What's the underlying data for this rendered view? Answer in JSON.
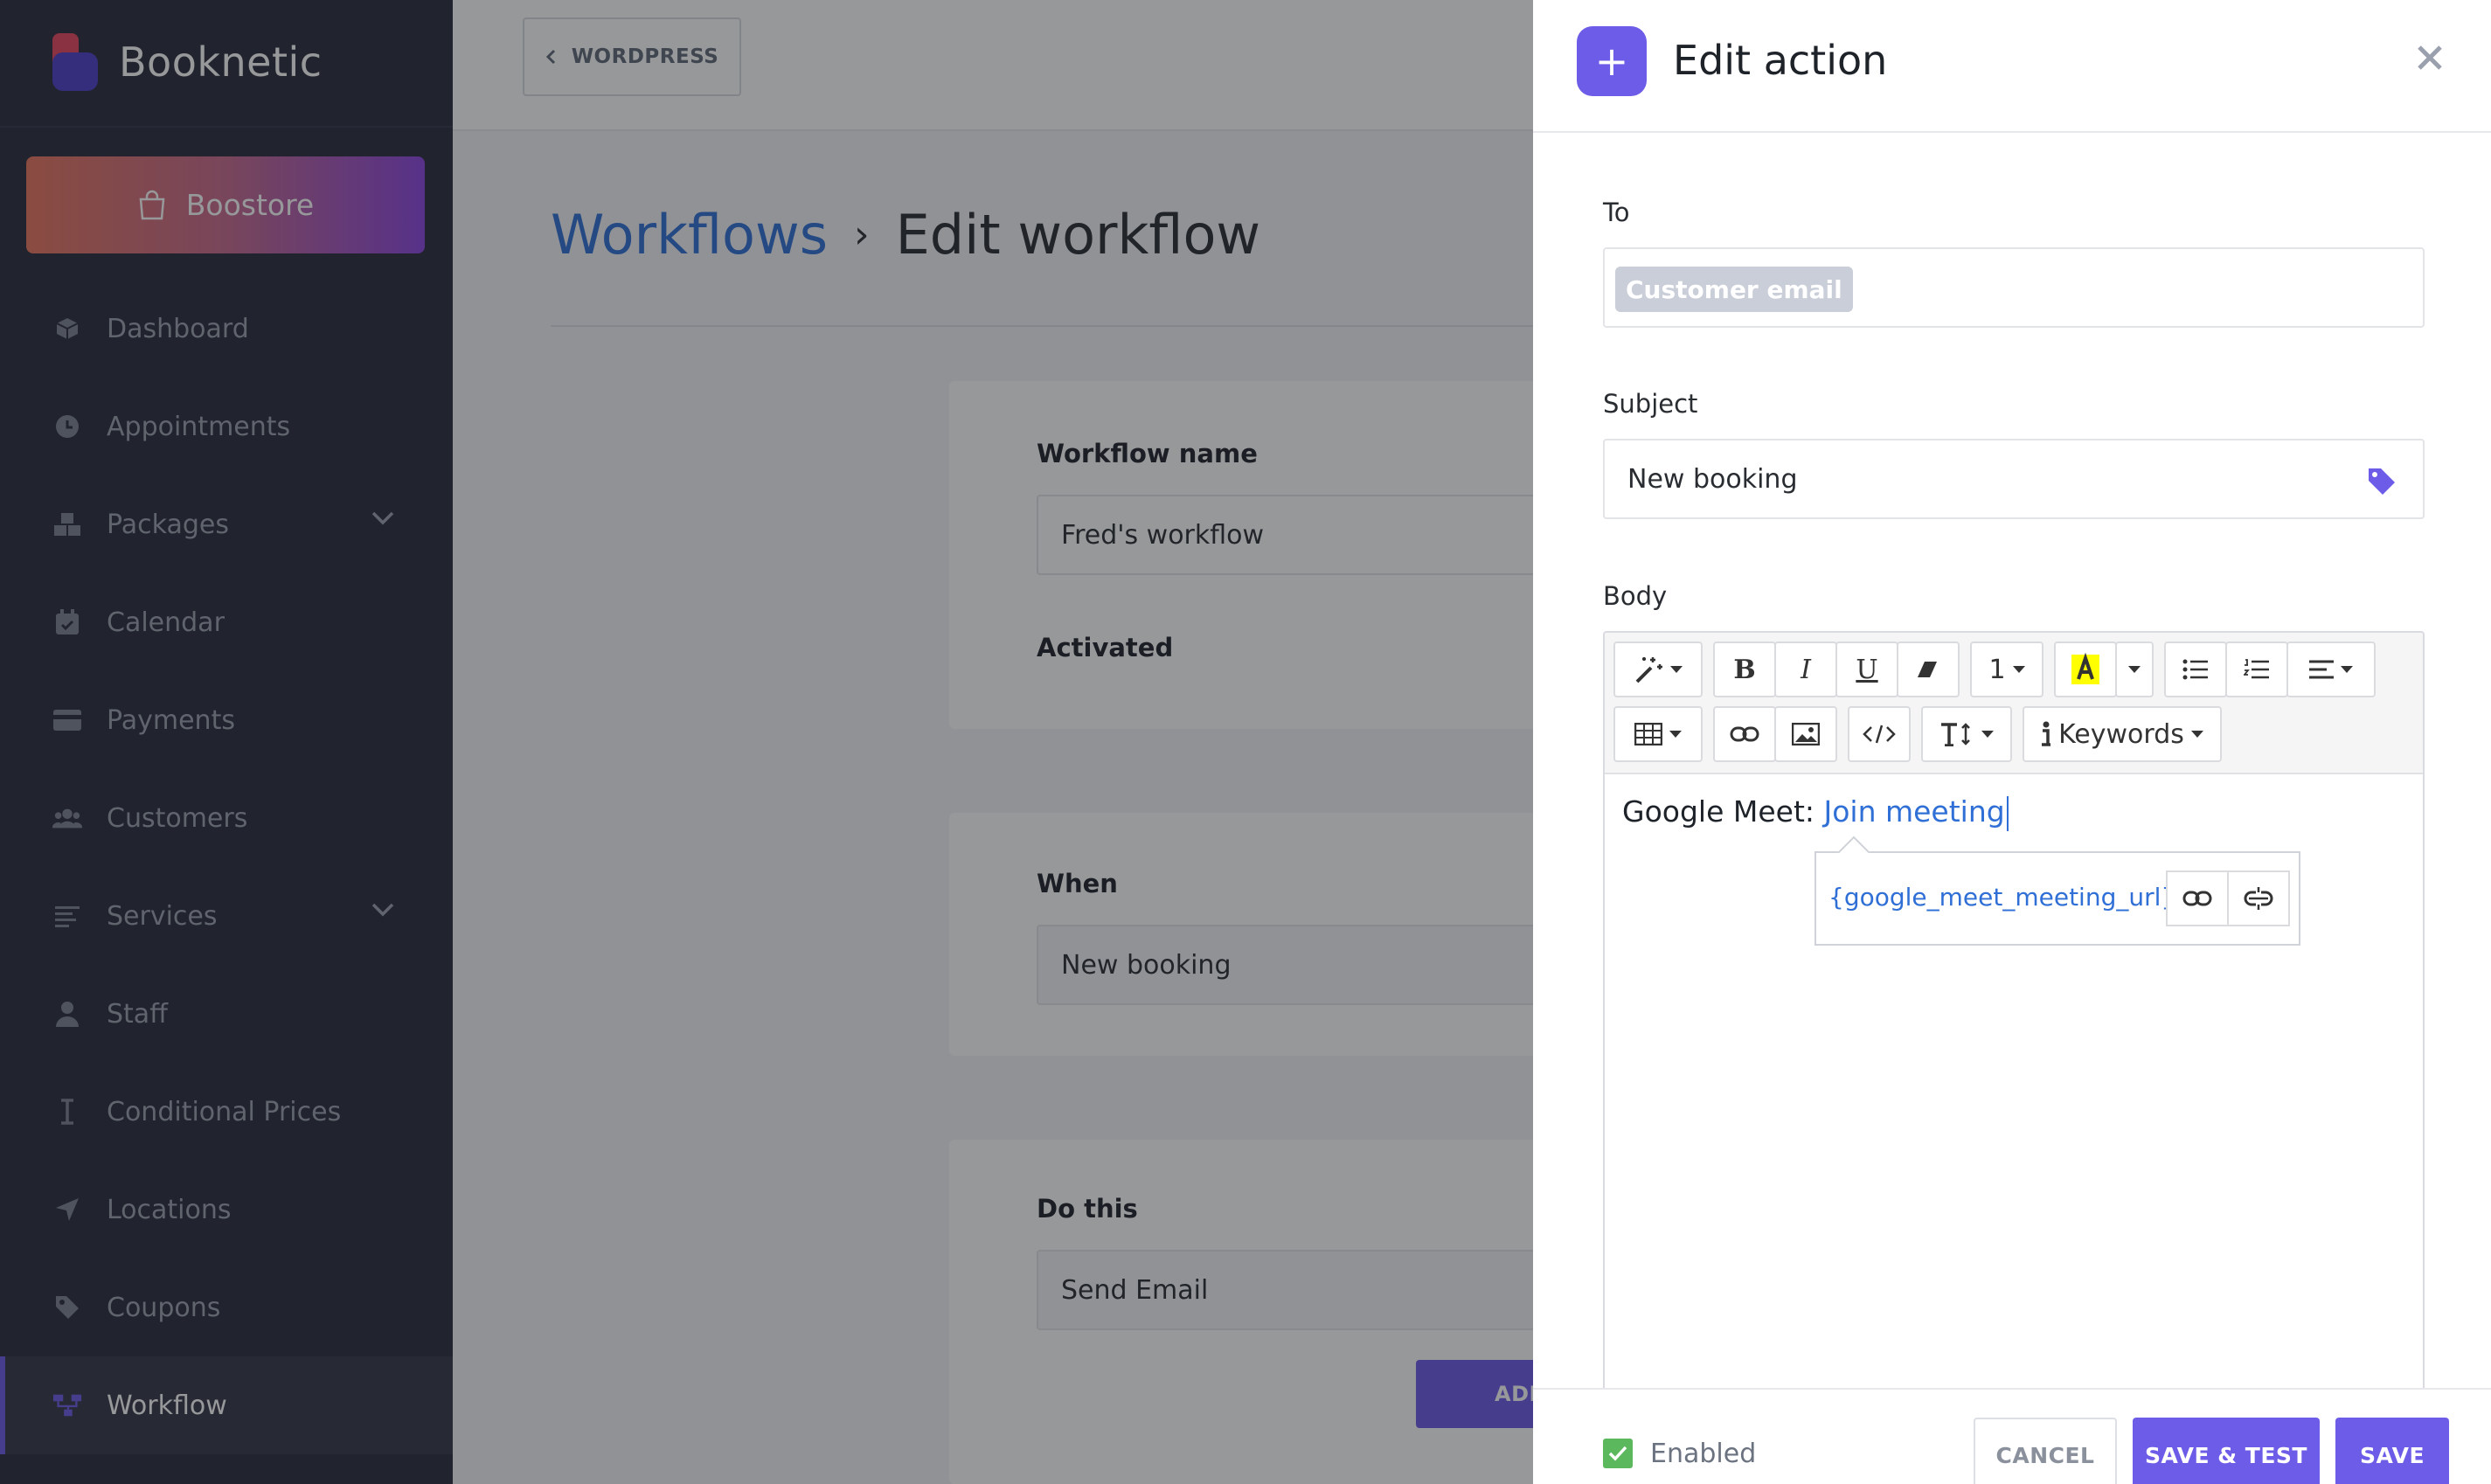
{
  "sidebar": {
    "brand": "Booknetic",
    "boostore_label": "Boostore",
    "items": [
      {
        "label": "Dashboard"
      },
      {
        "label": "Appointments"
      },
      {
        "label": "Packages"
      },
      {
        "label": "Calendar"
      },
      {
        "label": "Payments"
      },
      {
        "label": "Customers"
      },
      {
        "label": "Services"
      },
      {
        "label": "Staff"
      },
      {
        "label": "Conditional Prices"
      },
      {
        "label": "Locations"
      },
      {
        "label": "Coupons"
      },
      {
        "label": "Workflow"
      }
    ],
    "active_item": "Workflow"
  },
  "topbar": {
    "wordpress_label": "WORDPRESS"
  },
  "breadcrumb": {
    "parent": "Workflows",
    "separator": "›",
    "current": "Edit workflow"
  },
  "workflow": {
    "name_label": "Workflow name",
    "name_value": "Fred's workflow",
    "activated_label": "Activated",
    "activated": true,
    "when_label": "When",
    "when_value": "New booking",
    "do_label": "Do this",
    "do_value": "Send Email",
    "add_label": "ADD"
  },
  "panel": {
    "title": "Edit action",
    "to_label": "To",
    "to_chip": "Customer email",
    "subject_label": "Subject",
    "subject_value": "New booking",
    "body_label": "Body",
    "toolbar": {
      "font_size": "1",
      "keywords_label": "Keywords"
    },
    "body_prefix": "Google Meet: ",
    "body_link_text": "Join meeting",
    "link_url": "{google_meet_meeting_url}",
    "enabled_label": "Enabled",
    "enabled": true,
    "cancel_label": "CANCEL",
    "save_test_label": "SAVE & TEST",
    "save_label": "SAVE"
  },
  "colors": {
    "accent": "#6c5ce7",
    "link": "#2f6fd6",
    "sidebar_bg": "#292d3b",
    "success": "#5cb85c"
  }
}
